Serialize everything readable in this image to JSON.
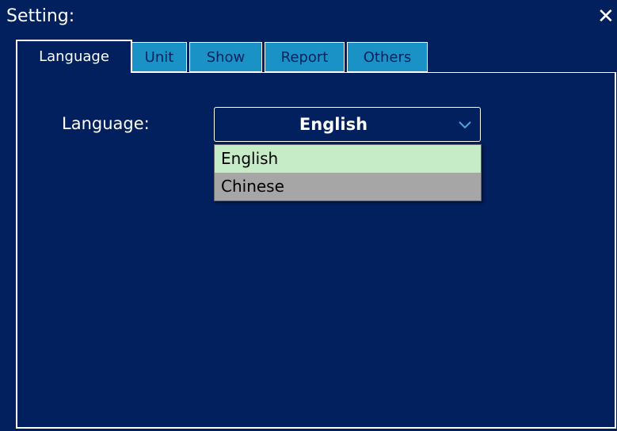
{
  "dialog": {
    "title": "Setting:",
    "close_glyph": "✕",
    "close_icon": "close-icon"
  },
  "tabs": [
    {
      "label": "Language",
      "active": true
    },
    {
      "label": "Unit",
      "active": false
    },
    {
      "label": "Show",
      "active": false
    },
    {
      "label": "Report",
      "active": false
    },
    {
      "label": "Others",
      "active": false
    }
  ],
  "language": {
    "label": "Language:",
    "selected": "English",
    "dropdown_icon": "chevron-down-icon",
    "options": [
      {
        "label": "English",
        "highlighted": true
      },
      {
        "label": "Chinese",
        "highlighted": false
      }
    ]
  },
  "colors": {
    "background": "#02205e",
    "tab_inactive": "#1a92c6",
    "option_highlight": "#c5ecc7",
    "option_hover": "#a6a6a6",
    "chevron": "#4fa3e0"
  }
}
